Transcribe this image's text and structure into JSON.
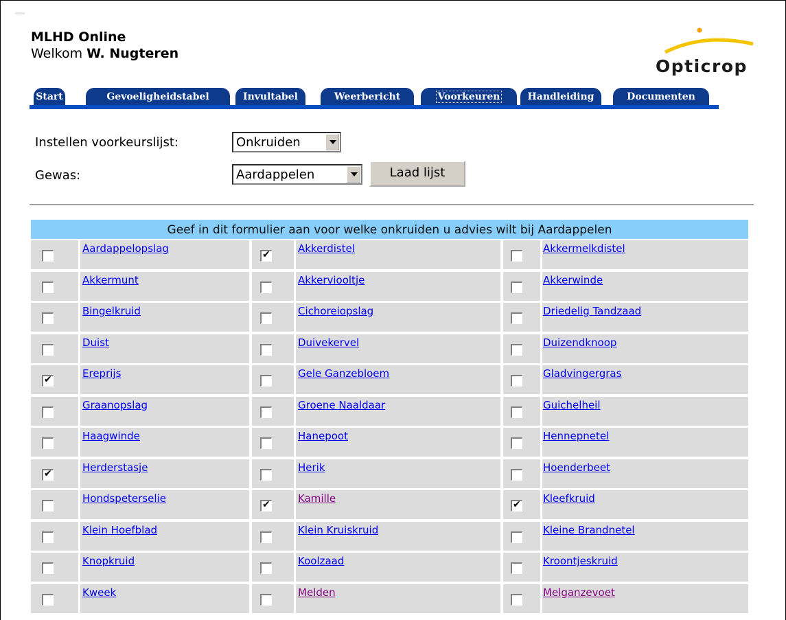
{
  "header": {
    "app_title": "MLHD Online",
    "welcome_prefix": "Welkom ",
    "user_name": "W. Nugteren"
  },
  "logo": {
    "text": "Opticrop",
    "arc_color": "#f5c400"
  },
  "tabs": [
    {
      "label": "Start",
      "active": false
    },
    {
      "label": "Gevoeligheidstabel",
      "active": false
    },
    {
      "label": "Invultabel",
      "active": false
    },
    {
      "label": "Weerbericht",
      "active": false
    },
    {
      "label": "Voorkeuren",
      "active": true
    },
    {
      "label": "Handleiding",
      "active": false
    },
    {
      "label": "Documenten",
      "active": false
    }
  ],
  "form": {
    "list_label": "Instellen voorkeurslijst:",
    "list_value": "Onkruiden",
    "crop_label": "Gewas:",
    "crop_value": "Aardappelen",
    "load_button": "Laad lijst"
  },
  "table": {
    "header": "Geef in dit formulier aan voor welke onkruiden u advies wilt bij Aardappelen",
    "rows": [
      [
        {
          "name": "Aardappelopslag",
          "checked": false,
          "visited": false
        },
        {
          "name": "Akkerdistel",
          "checked": true,
          "visited": false
        },
        {
          "name": "Akkermelkdistel",
          "checked": false,
          "visited": false
        }
      ],
      [
        {
          "name": "Akkermunt",
          "checked": false,
          "visited": false
        },
        {
          "name": "Akkerviooltje",
          "checked": false,
          "visited": false
        },
        {
          "name": "Akkerwinde",
          "checked": false,
          "visited": false
        }
      ],
      [
        {
          "name": "Bingelkruid",
          "checked": false,
          "visited": false
        },
        {
          "name": "Cichoreiopslag",
          "checked": false,
          "visited": false
        },
        {
          "name": "Driedelig Tandzaad",
          "checked": false,
          "visited": false
        }
      ],
      [
        {
          "name": "Duist",
          "checked": false,
          "visited": false
        },
        {
          "name": "Duivekervel",
          "checked": false,
          "visited": false
        },
        {
          "name": "Duizendknoop",
          "checked": false,
          "visited": false
        }
      ],
      [
        {
          "name": "Ereprijs",
          "checked": true,
          "visited": false
        },
        {
          "name": "Gele Ganzebloem",
          "checked": false,
          "visited": false
        },
        {
          "name": "Gladvingergras",
          "checked": false,
          "visited": false
        }
      ],
      [
        {
          "name": "Graanopslag",
          "checked": false,
          "visited": false
        },
        {
          "name": "Groene Naaldaar",
          "checked": false,
          "visited": false
        },
        {
          "name": "Guichelheil",
          "checked": false,
          "visited": false
        }
      ],
      [
        {
          "name": "Haagwinde",
          "checked": false,
          "visited": false
        },
        {
          "name": "Hanepoot",
          "checked": false,
          "visited": false
        },
        {
          "name": "Hennepnetel",
          "checked": false,
          "visited": false
        }
      ],
      [
        {
          "name": "Herderstasje",
          "checked": true,
          "visited": false
        },
        {
          "name": "Herik",
          "checked": false,
          "visited": false
        },
        {
          "name": "Hoenderbeet",
          "checked": false,
          "visited": false
        }
      ],
      [
        {
          "name": "Hondspeterselie",
          "checked": false,
          "visited": false
        },
        {
          "name": "Kamille",
          "checked": true,
          "visited": true
        },
        {
          "name": "Kleefkruid",
          "checked": true,
          "visited": false
        }
      ],
      [
        {
          "name": "Klein Hoefblad",
          "checked": false,
          "visited": false
        },
        {
          "name": "Klein Kruiskruid",
          "checked": false,
          "visited": false
        },
        {
          "name": "Kleine Brandnetel",
          "checked": false,
          "visited": false
        }
      ],
      [
        {
          "name": "Knopkruid",
          "checked": false,
          "visited": false
        },
        {
          "name": "Koolzaad",
          "checked": false,
          "visited": false
        },
        {
          "name": "Kroontjeskruid",
          "checked": false,
          "visited": false
        }
      ],
      [
        {
          "name": "Kweek",
          "checked": false,
          "visited": false
        },
        {
          "name": "Melden",
          "checked": false,
          "visited": true
        },
        {
          "name": "Melganzevoet",
          "checked": false,
          "visited": true
        }
      ]
    ]
  }
}
